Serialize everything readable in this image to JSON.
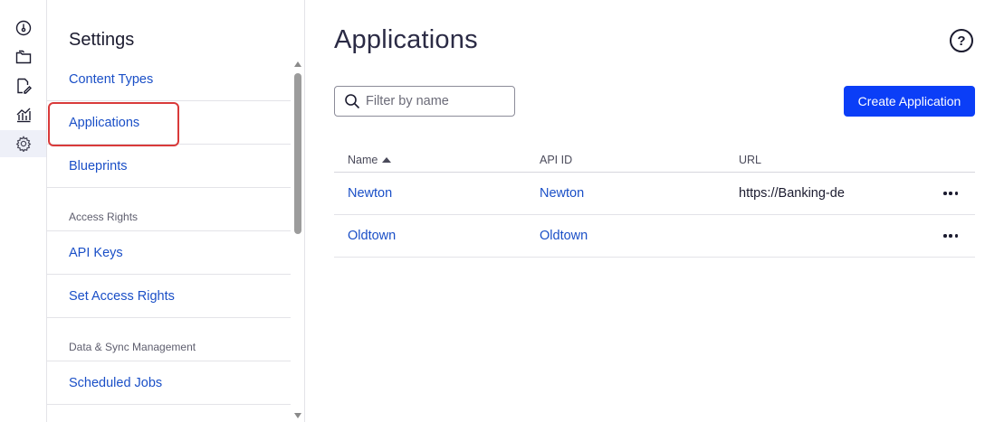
{
  "rail": {
    "items": [
      {
        "icon": "dashboard-icon",
        "active": false
      },
      {
        "icon": "folders-icon",
        "active": false
      },
      {
        "icon": "edit-document-icon",
        "active": false
      },
      {
        "icon": "analytics-icon",
        "active": false
      },
      {
        "icon": "gear-icon",
        "active": true
      }
    ]
  },
  "settings": {
    "title": "Settings",
    "items": [
      {
        "type": "link",
        "label": "Content Types"
      },
      {
        "type": "link",
        "label": "Applications",
        "highlighted": true
      },
      {
        "type": "link",
        "label": "Blueprints"
      },
      {
        "type": "section",
        "label": "Access Rights"
      },
      {
        "type": "link",
        "label": "API Keys"
      },
      {
        "type": "link",
        "label": "Set Access Rights"
      },
      {
        "type": "section",
        "label": "Data & Sync Management"
      },
      {
        "type": "link",
        "label": "Scheduled Jobs"
      }
    ]
  },
  "main": {
    "title": "Applications",
    "help_label": "?",
    "filter": {
      "placeholder": "Filter by name",
      "value": ""
    },
    "create_button": "Create Application",
    "table": {
      "headers": {
        "name": "Name",
        "api_id": "API ID",
        "url": "URL"
      },
      "sort": {
        "column": "name",
        "direction": "ascending"
      },
      "rows": [
        {
          "name": "Newton",
          "api_id": "Newton",
          "url": "https://Banking-de"
        },
        {
          "name": "Oldtown",
          "api_id": "Oldtown",
          "url": ""
        }
      ]
    }
  },
  "colors": {
    "accent": "#0b3ef7",
    "link": "#1a4fc7",
    "highlight_outline": "#d93a3a",
    "rail_active_bg": "#eef0f8"
  }
}
